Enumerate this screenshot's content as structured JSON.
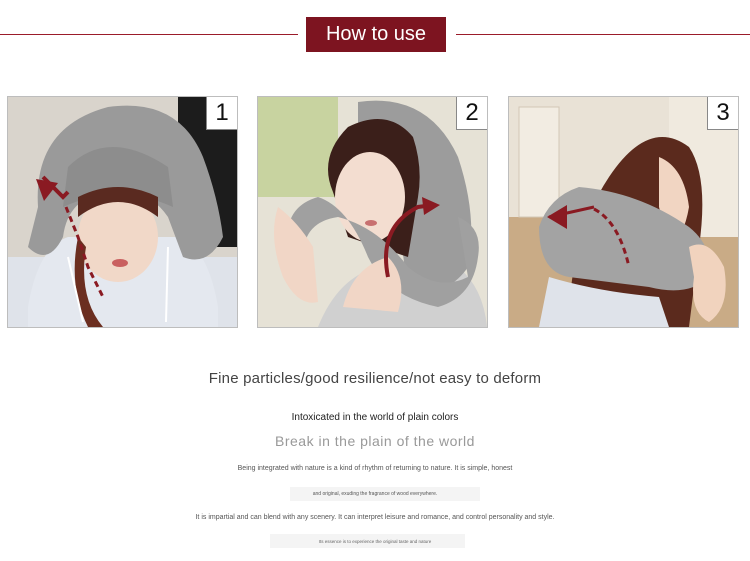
{
  "header": {
    "title": "How to use",
    "accent_color": "#7d1420"
  },
  "steps": [
    {
      "number": "1"
    },
    {
      "number": "2"
    },
    {
      "number": "3"
    }
  ],
  "text": {
    "headline": "Fine particles/good resilience/not easy to deform",
    "subtitle_1": "Intoxicated in the world of plain colors",
    "subtitle_2": "Break in the plain of the world",
    "para_1": "Being integrated with nature is a kind of rhythm of returning to nature. It is simple, honest",
    "para_2": "and original, exuding the fragrance of wood everywhere.",
    "para_3": "It is impartial and can blend with any scenery. It can interpret leisure and romance, and control personality and style.",
    "para_4": "Its essence is to experience the original taste and nature"
  }
}
